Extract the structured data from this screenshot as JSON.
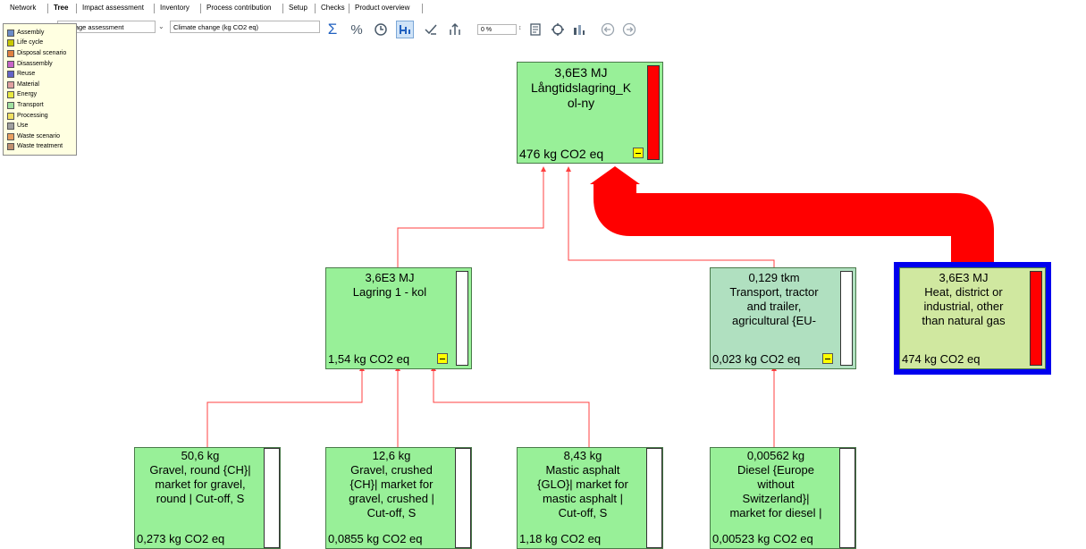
{
  "tabs": [
    "Network",
    "Tree",
    "Impact assessment",
    "Inventory",
    "Process contribution",
    "Setup",
    "Checks",
    "Product overview"
  ],
  "active_tab": "Tree",
  "toolbar": {
    "method_value": "Damage assessment",
    "indicator_value": "Climate change (kg CO2 eq)",
    "cutoff_value": "0 %"
  },
  "legend": [
    {
      "label": "Assembly",
      "color": "#6b8cc8"
    },
    {
      "label": "Life cycle",
      "color": "#c8c800"
    },
    {
      "label": "Disposal scenario",
      "color": "#e08040"
    },
    {
      "label": "Disassembly",
      "color": "#c864c8"
    },
    {
      "label": "Reuse",
      "color": "#6464c8"
    },
    {
      "label": "Material",
      "color": "#e0a0a0"
    },
    {
      "label": "Energy",
      "color": "#e8e840"
    },
    {
      "label": "Transport",
      "color": "#a0e0a0"
    },
    {
      "label": "Processing",
      "color": "#f0e060"
    },
    {
      "label": "Use",
      "color": "#a0a0a0"
    },
    {
      "label": "Waste scenario",
      "color": "#e8a060"
    },
    {
      "label": "Waste treatment",
      "color": "#c09070"
    }
  ],
  "nodes": {
    "root": {
      "label": "3,6E3 MJ\nLångtidslagring_K\nol-ny",
      "impact": "476 kg CO2 eq",
      "share": 1.0
    },
    "lagring": {
      "label": "3,6E3 MJ\nLagring 1 - kol",
      "impact": "1,54 kg CO2 eq",
      "share": 0.003
    },
    "transport": {
      "label": "0,129 tkm\nTransport, tractor\nand trailer,\nagricultural {EU-",
      "impact": "0,023 kg CO2 eq",
      "share": 0.0
    },
    "heat": {
      "label": "3,6E3 MJ\nHeat, district or\nindustrial, other\nthan natural gas",
      "impact": "474 kg CO2 eq",
      "share": 1.0
    },
    "gravel_round": {
      "label": "50,6 kg\nGravel, round {CH}|\nmarket for gravel,\nround | Cut-off, S",
      "impact": "0,273 kg CO2 eq",
      "share": 0.0
    },
    "gravel_crushed": {
      "label": "12,6 kg\nGravel, crushed\n{CH}| market for\ngravel, crushed |\nCut-off, S",
      "impact": "0,0855 kg CO2 eq",
      "share": 0.0
    },
    "mastic": {
      "label": "8,43 kg\nMastic asphalt\n{GLO}| market for\nmastic asphalt |\nCut-off, S",
      "impact": "1,18 kg CO2 eq",
      "share": 0.0
    },
    "diesel": {
      "label": "0,00562 kg\nDiesel {Europe\nwithout\nSwitzerland}|\nmarket for diesel |",
      "impact": "0,00523 kg CO2 eq",
      "share": 0.0
    }
  },
  "colors": {
    "node_fill": "#98f098",
    "transport_fill": "#b0e0c0",
    "heat_fill": "#d0e8a0",
    "flow": "#ff0000",
    "selection": "#0000ee"
  }
}
